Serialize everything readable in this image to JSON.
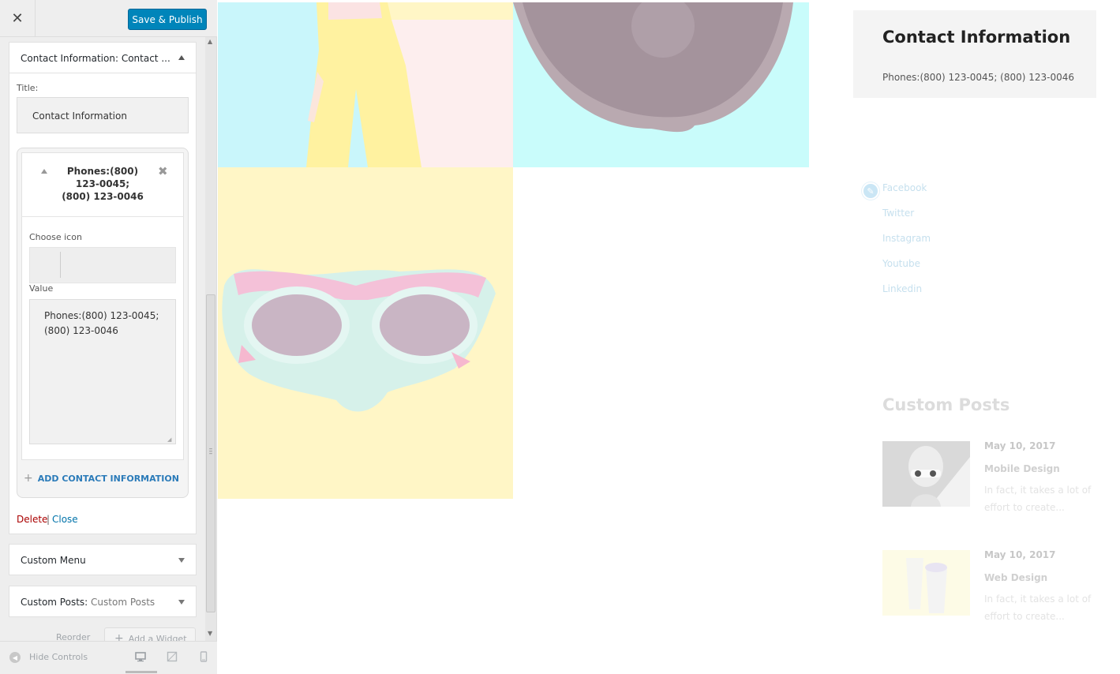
{
  "toolbar": {
    "close_icon": "close-icon",
    "publish_label": "Save & Publish"
  },
  "contact_widget": {
    "header_label": "Contact Information: Contact ...",
    "title_label": "Title:",
    "title_value": "Contact Information",
    "item": {
      "title": "Phones:(800) 123-0045; (800) 123-0046",
      "choose_icon_label": "Choose icon",
      "value_label": "Value",
      "value": "Phones:(800) 123-0045;\n(800) 123-0046"
    },
    "add_label": "ADD CONTACT INFORMATION",
    "delete_label": "Delete",
    "separator": "|",
    "close_label": "Close"
  },
  "other_widgets": {
    "custom_menu": "Custom Menu",
    "custom_posts_prefix": "Custom Posts:",
    "custom_posts_name": "Custom Posts"
  },
  "sidebar_actions": {
    "reorder": "Reorder",
    "add_widget": "Add a Widget"
  },
  "footer": {
    "hide_controls": "Hide Controls"
  },
  "preview": {
    "contact_title": "Contact Information",
    "contact_phones": "Phones:(800) 123-0045; (800) 123-0046",
    "social_links": [
      "Facebook",
      "Twitter",
      "Instagram",
      "Youtube",
      "Linkedin"
    ],
    "posts_title": "Custom Posts",
    "posts": [
      {
        "date": "May 10, 2017",
        "title": "Mobile Design",
        "excerpt": "In fact, it takes a lot of effort to create..."
      },
      {
        "date": "May 10, 2017",
        "title": "Web Design",
        "excerpt": "In fact, it takes a lot of effort to create..."
      }
    ]
  },
  "colors": {
    "publish_button": "#0085ba",
    "link_blue": "#0073aa",
    "delete_red": "#aa0000",
    "tile_cyan": "#c9f6fb",
    "tile_yellow": "#fff6c6"
  }
}
